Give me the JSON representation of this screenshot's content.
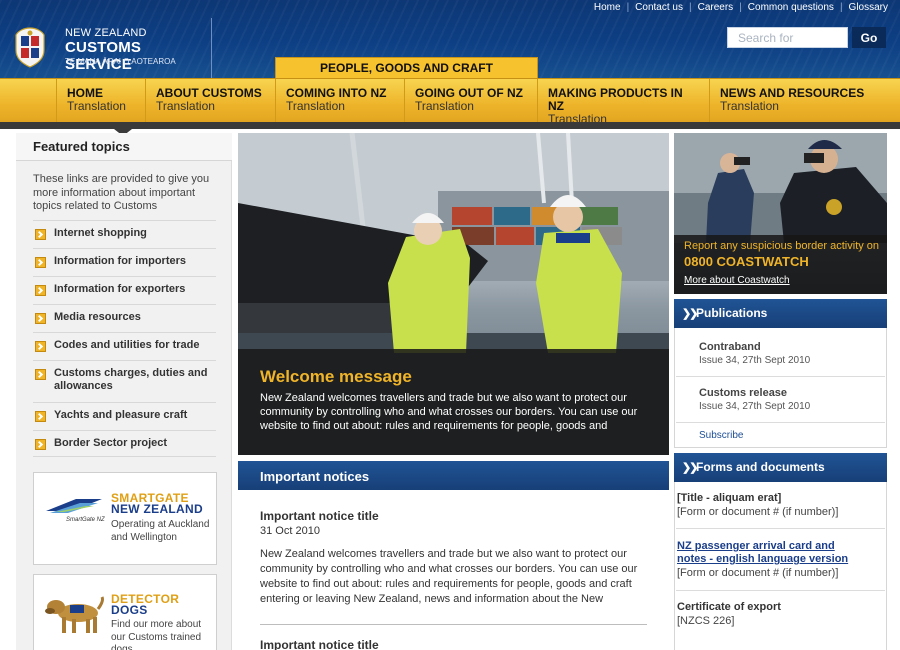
{
  "utility_nav": [
    "Home",
    "Contact us",
    "Careers",
    "Common questions",
    "Glossary"
  ],
  "logo": {
    "line1": "NEW ZEALAND",
    "line2": "CUSTOMS SERVICE",
    "line3": "TE MANA ĀRAI O AOTEAROA"
  },
  "search": {
    "placeholder": "Search for",
    "button": "Go"
  },
  "section_tab": "PEOPLE, GOODS AND CRAFT",
  "nav": [
    {
      "title": "HOME",
      "sub": "Translation"
    },
    {
      "title": "ABOUT CUSTOMS",
      "sub": "Translation"
    },
    {
      "title": "COMING INTO NZ",
      "sub": "Translation"
    },
    {
      "title": "GOING OUT OF NZ",
      "sub": "Translation"
    },
    {
      "title": "MAKING PRODUCTS IN NZ",
      "sub": "Translation"
    },
    {
      "title": "NEWS AND RESOURCES",
      "sub": "Translation"
    }
  ],
  "sidebar": {
    "heading": "Featured topics",
    "intro": "These links are provided to give you more information about important topics related to Customs",
    "links": [
      "Internet shopping",
      "Information for importers",
      "Information for exporters",
      "Media resources",
      "Codes and utilities for trade",
      "Customs charges, duties and allowances",
      "Yachts and pleasure craft",
      "Border Sector project"
    ],
    "promos": [
      {
        "title1": "SMARTGATE",
        "title2": "NEW ZEALAND",
        "text": "Operating at Auckland and Wellington",
        "logo_caption": "SmartGate NZ"
      },
      {
        "title1": "DETECTOR",
        "title2": "DOGS",
        "text": "Find our more about our Customs trained dogs"
      }
    ]
  },
  "hero": {
    "title": "Welcome message",
    "text": "New Zealand welcomes travellers and trade but we also want to protect our community by controlling who and what crosses our borders.  You can use our website to find out about: rules and requirements for people, goods and"
  },
  "notices": {
    "heading": "Important notices",
    "items": [
      {
        "title": "Important notice title",
        "date": "31 Oct 2010",
        "text": "New Zealand welcomes travellers and trade but we also want to protect our community by controlling who and what crosses our borders.  You can use our website to find out about: rules and requirements for people, goods and craft entering or leaving New Zealand, news and information about the New"
      },
      {
        "title": "Important notice title"
      }
    ]
  },
  "coastwatch": {
    "text": "Report any suspicious border activity on",
    "number": "0800 COASTWATCH",
    "link": "More about Coastwatch"
  },
  "publications": {
    "heading": "Publications",
    "items": [
      {
        "title": "Contraband",
        "date": "Issue 34, 27th Sept 2010"
      },
      {
        "title": "Customs release",
        "date": "Issue 34, 27th Sept 2010"
      }
    ],
    "subscribe": "Subscribe"
  },
  "forms": {
    "heading": "Forms and documents",
    "items": [
      {
        "title": "[Title - aliquam erat]",
        "sub": "[Form or document # (if number)]"
      },
      {
        "title": "NZ passenger arrival card and notes - english language version",
        "sub": "[Form or document # (if number)]"
      },
      {
        "title": "Certificate of export",
        "sub": "[NZCS 226]"
      }
    ]
  },
  "colors": {
    "navy": "#173f78",
    "gold": "#f0b429",
    "link_blue": "#1b3e8a"
  },
  "icons": [
    "crest-icon",
    "chevron-right-icon",
    "double-chevron-icon",
    "smartgate-logo-icon",
    "detector-dog-icon"
  ]
}
